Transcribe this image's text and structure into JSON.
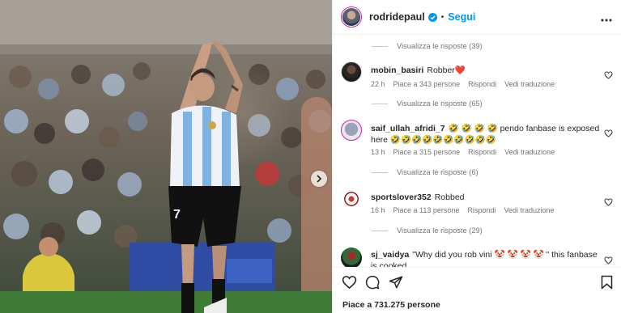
{
  "post": {
    "username": "rodridepaul",
    "separator": "•",
    "follow_label": "Segui",
    "verified_icon": "verified-badge-icon",
    "more_icon": "more-options-icon",
    "jersey_number": "7"
  },
  "replies_toggles": [
    "Visualizza le risposte (39)",
    "Visualizza le risposte (65)",
    "Visualizza le risposte (6)",
    "Visualizza le risposte (29)"
  ],
  "comments": [
    {
      "username": "mobin_basiri",
      "text": "Robber❤️",
      "time": "22 h",
      "likes": "Piace a 343 persone",
      "reply": "Rispondi",
      "translate": "Vedi traduzione"
    },
    {
      "username": "saif_ullah_afridi_7",
      "text": "🤣 🤣 🤣 🤣 pendo fanbase is exposed here 🤣🤣🤣🤣🤣🤣🤣🤣🤣🤣",
      "time": "13 h",
      "likes": "Piace a 315 persone",
      "reply": "Rispondi",
      "translate": "Vedi traduzione"
    },
    {
      "username": "sportslover352",
      "text": "Robbed",
      "time": "16 h",
      "likes": "Piace a 113 persone",
      "reply": "Rispondi",
      "translate": "Vedi traduzione"
    },
    {
      "username": "sj_vaidya",
      "text": "\"Why did you rob vini 🤡 🤡 🤡 🤡 \" this fanbase is cooked"
    }
  ],
  "actions": {
    "icons": [
      "heart-icon",
      "comment-icon",
      "share-icon",
      "bookmark-icon"
    ],
    "likes_label": "Piace a 731.275 persone"
  },
  "colors": {
    "accent": "#0095f6",
    "text": "#262626",
    "secondary": "#737373",
    "heart_red": "#ed4956",
    "divider": "#efefef"
  }
}
